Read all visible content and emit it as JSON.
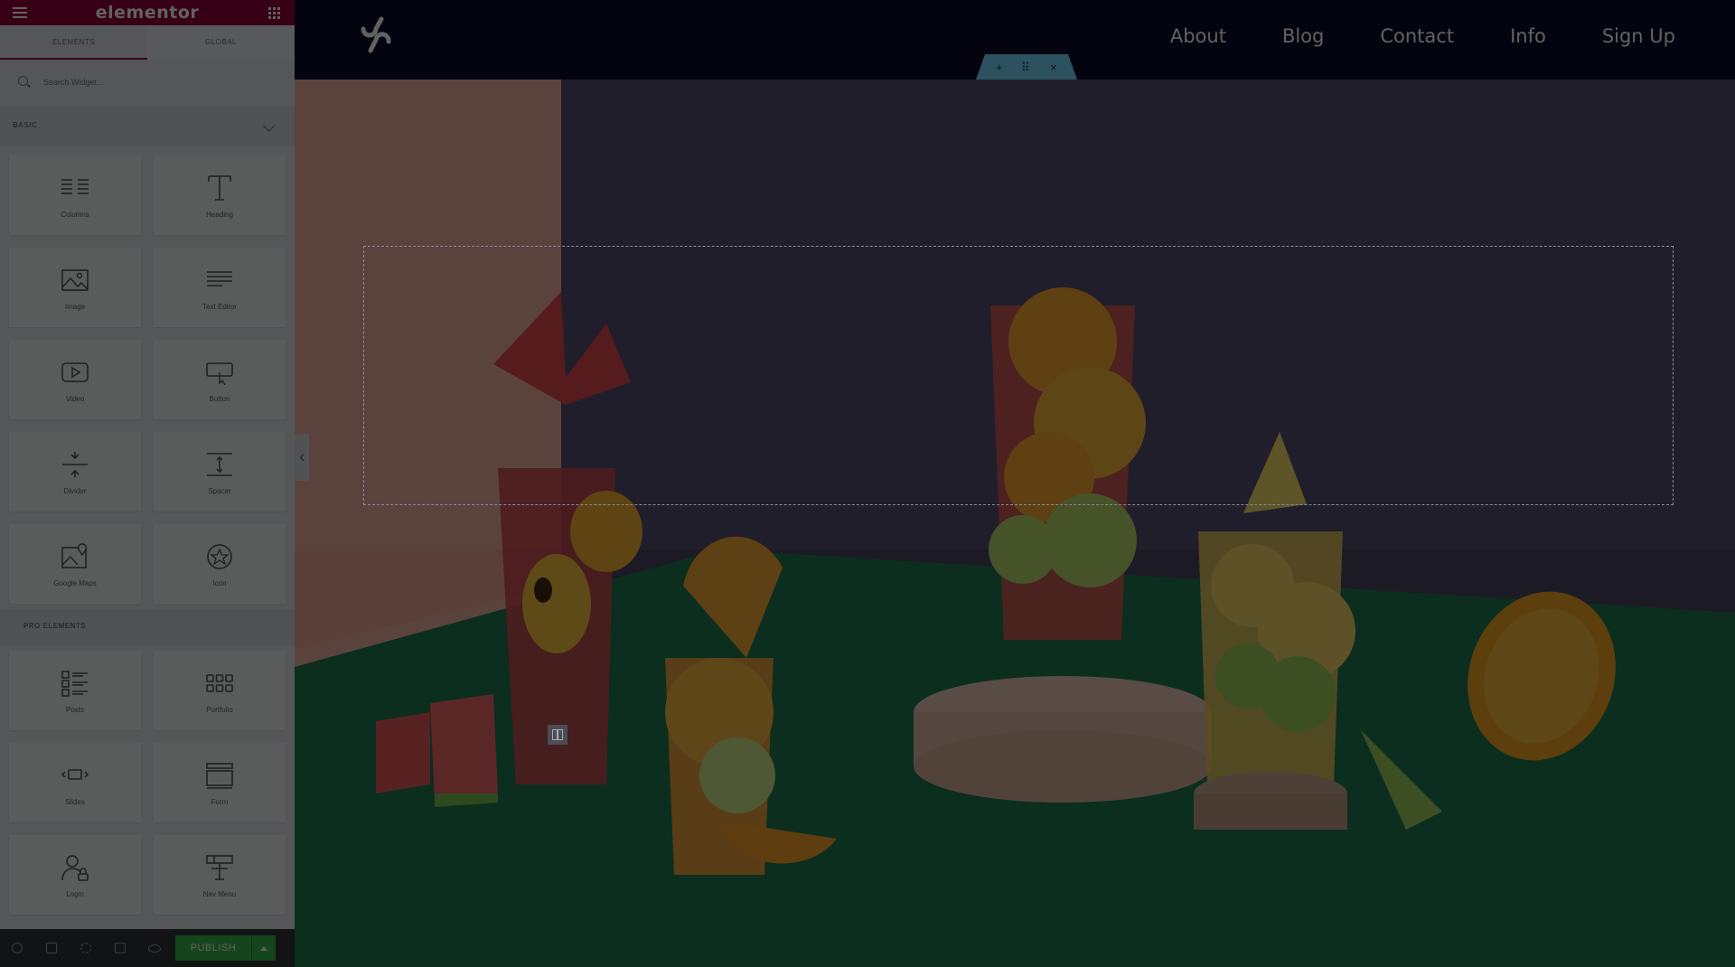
{
  "app": {
    "logo": "elementor",
    "menu_icon": "hamburger-icon",
    "apps_icon": "grid-icon"
  },
  "tabs": [
    {
      "label": "ELEMENTS",
      "active": true
    },
    {
      "label": "GLOBAL",
      "active": false
    }
  ],
  "search": {
    "placeholder": "Search Widget..."
  },
  "sections": {
    "basic": {
      "title": "BASIC"
    },
    "pro": {
      "title": "PRO ELEMENTS"
    }
  },
  "widgets_basic": [
    {
      "label": "Columns",
      "icon": "columns-icon"
    },
    {
      "label": "Heading",
      "icon": "heading-icon"
    },
    {
      "label": "Image",
      "icon": "image-icon"
    },
    {
      "label": "Text Editor",
      "icon": "text-editor-icon"
    },
    {
      "label": "Video",
      "icon": "video-icon"
    },
    {
      "label": "Button",
      "icon": "button-icon"
    },
    {
      "label": "Divider",
      "icon": "divider-icon"
    },
    {
      "label": "Spacer",
      "icon": "spacer-icon"
    },
    {
      "label": "Google Maps",
      "icon": "google-maps-icon"
    },
    {
      "label": "Icon",
      "icon": "star-icon"
    }
  ],
  "widgets_pro": [
    {
      "label": "Posts",
      "icon": "posts-icon"
    },
    {
      "label": "Portfolio",
      "icon": "portfolio-icon"
    },
    {
      "label": "Slides",
      "icon": "slides-icon"
    },
    {
      "label": "Form",
      "icon": "form-icon"
    },
    {
      "label": "Login",
      "icon": "login-icon"
    },
    {
      "label": "Nav Menu",
      "icon": "nav-menu-icon"
    }
  ],
  "footer": {
    "publish_label": "PUBLISH",
    "icons": [
      "settings-icon",
      "navigator-icon",
      "history-icon",
      "responsive-icon",
      "preview-icon"
    ]
  },
  "site": {
    "nav": [
      "About",
      "Blog",
      "Contact",
      "Info",
      "Sign Up"
    ],
    "handle": {
      "add": "+",
      "move": "⠿",
      "close": "×"
    }
  },
  "colors": {
    "brand": "#93003a",
    "publish": "#39b54a",
    "site_header": "#0b0d2c",
    "section_handle": "#71d7f7"
  }
}
